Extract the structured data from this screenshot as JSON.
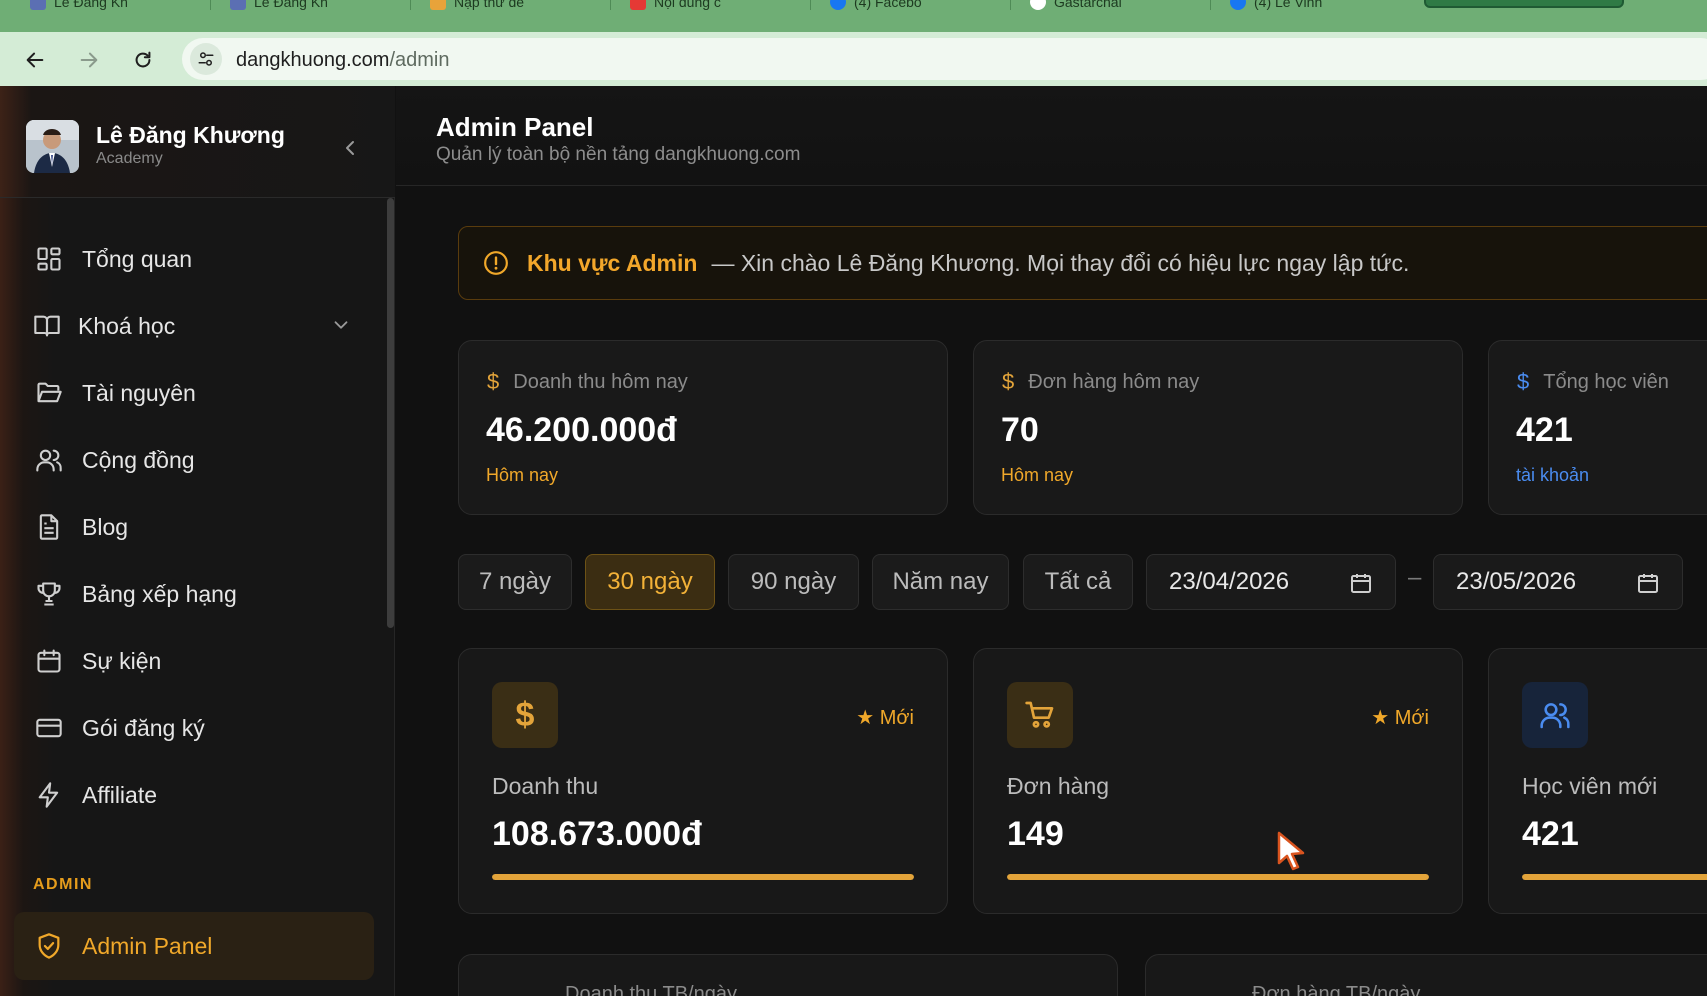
{
  "browser": {
    "tabs": [
      {
        "label": "Lê Đăng Kh",
        "favicon_color": "#5b6fb3"
      },
      {
        "label": "Lê Đăng Kh",
        "favicon_color": "#5b6fb3"
      },
      {
        "label": "Nạp thư đế",
        "favicon_color": "#e8a33a"
      },
      {
        "label": "Nội dung c",
        "favicon_color": "#e53935"
      },
      {
        "label": "(4) Facebo",
        "favicon_color": "#1877f2"
      },
      {
        "label": "Gastarchai",
        "favicon_color": "#ffffff"
      },
      {
        "label": "(4) Lê Vinh",
        "favicon_color": "#1877f2"
      }
    ],
    "url_domain": "dangkhuong.com",
    "url_path": "/admin"
  },
  "sidebar": {
    "brand_name": "Lê Đăng Khương",
    "brand_sub": "Academy",
    "items": [
      {
        "label": "Tổng quan",
        "icon": "dashboard-grid-icon"
      },
      {
        "label": "Khoá học",
        "icon": "book-open-icon"
      },
      {
        "label": "Tài nguyên",
        "icon": "folder-open-icon"
      },
      {
        "label": "Cộng đồng",
        "icon": "users-icon"
      },
      {
        "label": "Blog",
        "icon": "document-icon"
      },
      {
        "label": "Bảng xếp hạng",
        "icon": "trophy-icon"
      },
      {
        "label": "Sự kiện",
        "icon": "calendar-icon"
      },
      {
        "label": "Gói đăng ký",
        "icon": "credit-card-icon"
      },
      {
        "label": "Affiliate",
        "icon": "lightning-icon"
      }
    ],
    "section_admin": "ADMIN",
    "admin_item": {
      "label": "Admin Panel",
      "icon": "shield-check-icon"
    }
  },
  "header": {
    "title": "Admin Panel",
    "subtitle": "Quản lý toàn bộ nền tảng dangkhuong.com"
  },
  "alert": {
    "strong": "Khu vực Admin",
    "text": "— Xin chào Lê Đăng Khương. Mọi thay đổi có hiệu lực ngay lập tức."
  },
  "stats": [
    {
      "label": "Doanh thu hôm nay",
      "value": "46.200.000đ",
      "sub": "Hôm nay",
      "icon_color": "#e3a43a",
      "sub_color": "#f0a82a"
    },
    {
      "label": "Đơn hàng hôm nay",
      "value": "70",
      "sub": "Hôm nay",
      "icon_color": "#e3a43a",
      "sub_color": "#f0a82a"
    },
    {
      "label": "Tổng học viên",
      "value": "421",
      "sub": "tài khoản",
      "icon_color": "#4a8cf0",
      "sub_color": "#4a8cf0"
    }
  ],
  "filters": {
    "ranges": [
      "7 ngày",
      "30 ngày",
      "90 ngày",
      "Năm nay",
      "Tất cả"
    ],
    "active_range": "30 ngày",
    "date_from": "23/04/2026",
    "date_to": "23/05/2026",
    "separator": "–"
  },
  "metrics": [
    {
      "label": "Doanh thu",
      "value": "108.673.000đ",
      "badge": "★ Mới",
      "icon": "dollar-icon",
      "progress": 1.0
    },
    {
      "label": "Đơn hàng",
      "value": "149",
      "badge": "★ Mới",
      "icon": "shopping-cart-icon",
      "progress": 1.0
    },
    {
      "label": "Học viên mới",
      "value": "421",
      "badge": "",
      "icon": "users-icon",
      "progress": 1.0
    }
  ],
  "averages": [
    {
      "label": "Doanh thu TB/ngày"
    },
    {
      "label": "Đơn hàng TB/ngày"
    }
  ],
  "colors": {
    "accent": "#f0a82a",
    "blue": "#4a8cf0",
    "background": "#111111"
  }
}
